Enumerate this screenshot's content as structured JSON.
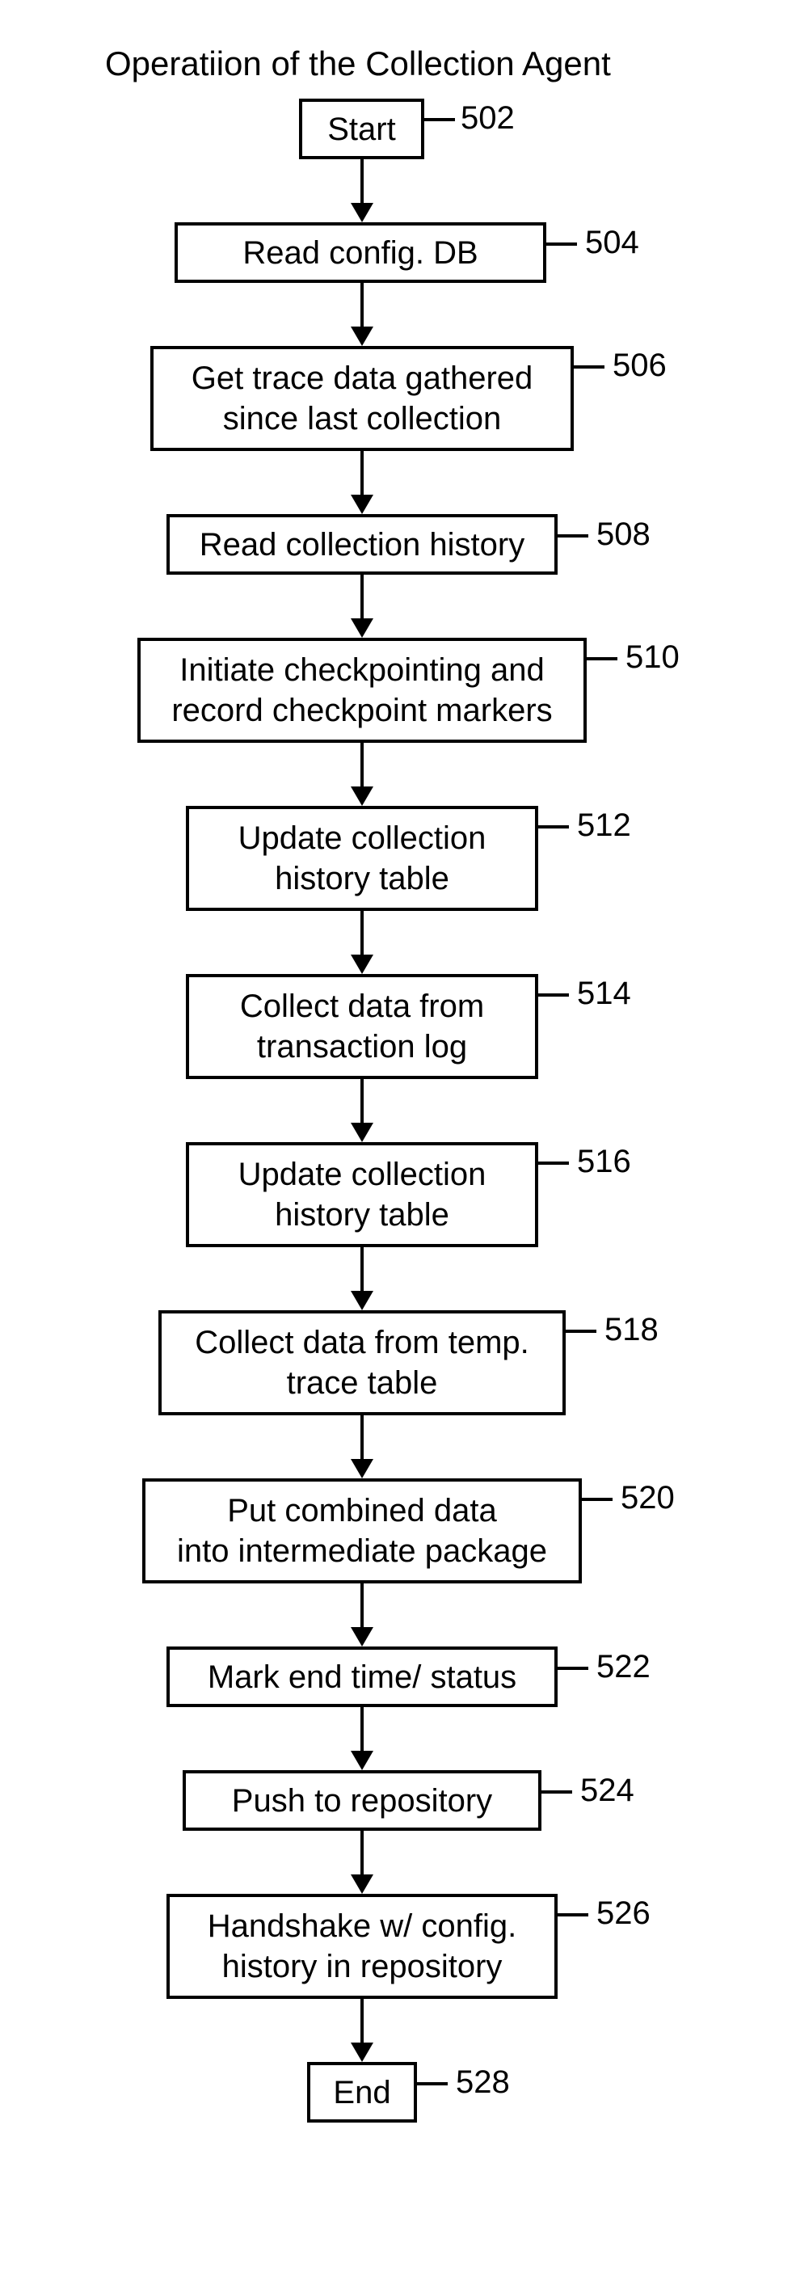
{
  "title": "Operatiion of the Collection Agent",
  "steps": [
    {
      "label": "Start",
      "ref": "502"
    },
    {
      "label": "Read config. DB",
      "ref": "504"
    },
    {
      "label": "Get trace data gathered\nsince last collection",
      "ref": "506"
    },
    {
      "label": "Read collection history",
      "ref": "508"
    },
    {
      "label": "Initiate checkpointing and\nrecord checkpoint markers",
      "ref": "510"
    },
    {
      "label": "Update collection\nhistory table",
      "ref": "512"
    },
    {
      "label": "Collect data from\ntransaction log",
      "ref": "514"
    },
    {
      "label": "Update collection\nhistory table",
      "ref": "516"
    },
    {
      "label": "Collect data from temp.\ntrace table",
      "ref": "518"
    },
    {
      "label": "Put combined data\ninto intermediate package",
      "ref": "520"
    },
    {
      "label": "Mark end time/ status",
      "ref": "522"
    },
    {
      "label": "Push to repository",
      "ref": "524"
    },
    {
      "label": "Handshake w/ config.\nhistory in repository",
      "ref": "526"
    },
    {
      "label": "End",
      "ref": "528"
    }
  ]
}
